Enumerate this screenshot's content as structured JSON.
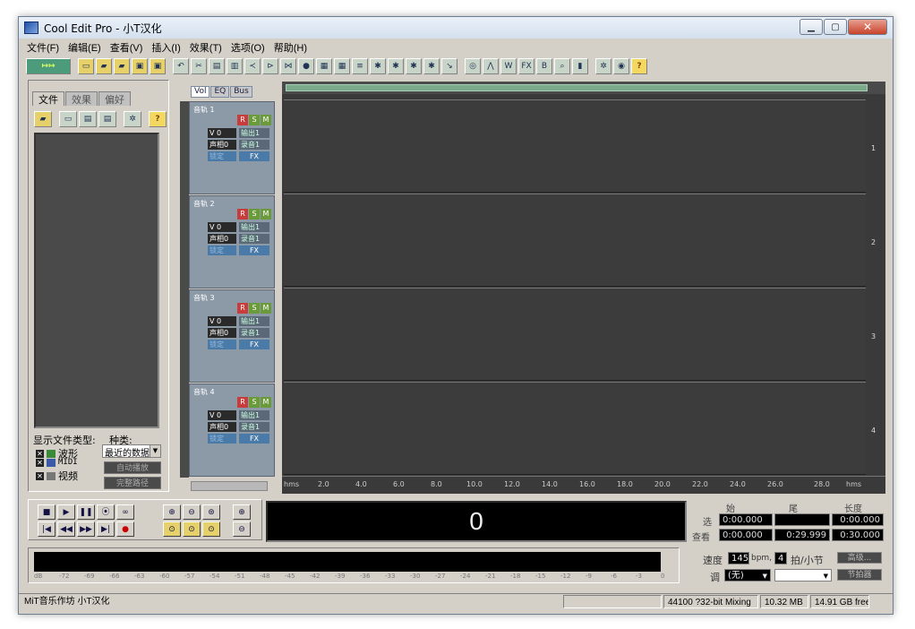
{
  "window": {
    "title": "Cool Edit Pro  - 小T汉化"
  },
  "menu": [
    "文件(F)",
    "编辑(E)",
    "查看(V)",
    "插入(I)",
    "效果(T)",
    "选项(O)",
    "帮助(H)"
  ],
  "left_panel": {
    "tabs": [
      "文件",
      "效果",
      "偏好"
    ],
    "file_type_label": "显示文件类型:",
    "kind_label": "种类:",
    "checks": [
      "波形",
      "MIDI",
      "视频"
    ],
    "kind_select": "最近的数据",
    "btn_auto": "自动播放",
    "btn_full": "完整路径"
  },
  "track_panel": {
    "tabs": [
      "Vol",
      "EQ",
      "Bus"
    ],
    "tracks": [
      {
        "name": "音轨 1",
        "vol": "V 0",
        "pan": "声相0",
        "out": "输出1",
        "rec": "录音1",
        "lock": "锁定",
        "fx": "FX",
        "lane": "1"
      },
      {
        "name": "音轨 2",
        "vol": "V 0",
        "pan": "声相0",
        "out": "输出1",
        "rec": "录音1",
        "lock": "锁定",
        "fx": "FX",
        "lane": "2"
      },
      {
        "name": "音轨 3",
        "vol": "V 0",
        "pan": "声相0",
        "out": "输出1",
        "rec": "录音1",
        "lock": "锁定",
        "fx": "FX",
        "lane": "3"
      },
      {
        "name": "音轨 4",
        "vol": "V 0",
        "pan": "声相0",
        "out": "输出1",
        "rec": "录音1",
        "lock": "锁定",
        "fx": "FX",
        "lane": "4"
      }
    ]
  },
  "ruler": [
    "hms",
    "2.0",
    "4.0",
    "6.0",
    "8.0",
    "10.0",
    "12.0",
    "14.0",
    "16.0",
    "18.0",
    "20.0",
    "22.0",
    "24.0",
    "26.0",
    "28.0",
    "hms"
  ],
  "time_display": "0",
  "time_info": {
    "h_start": "始",
    "h_end": "尾",
    "h_len": "长度",
    "sel": "选",
    "view": "查看",
    "sel_start": "0:00.000",
    "sel_end": "",
    "sel_len": "0:00.000",
    "view_start": "0:00.000",
    "view_end": "0:29.999",
    "view_len": "0:30.000"
  },
  "level_ticks": [
    "dB",
    "-72",
    "-69",
    "-66",
    "-63",
    "-60",
    "-57",
    "-54",
    "-51",
    "-48",
    "-45",
    "-42",
    "-39",
    "-36",
    "-33",
    "-30",
    "-27",
    "-24",
    "-21",
    "-18",
    "-15",
    "-12",
    "-9",
    "-6",
    "-3",
    "0"
  ],
  "tempo": {
    "speed_label": "速度",
    "speed": "145",
    "bpm": "bpm,",
    "beats": "4",
    "beats_label": "拍/小节",
    "key_label": "调",
    "key": "(无)",
    "adv_btn": "高级...",
    "metro_btn": "节拍器"
  },
  "status": {
    "left": "MiT音乐作坊 小T汉化",
    "format": "44100 ?32-bit Mixing",
    "mem": "10.32 MB",
    "free": "14.91 GB free"
  }
}
